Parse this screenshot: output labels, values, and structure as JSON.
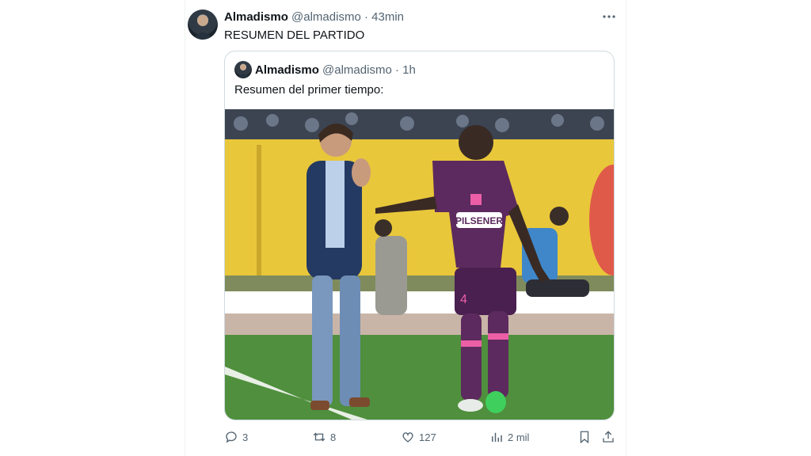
{
  "tweet": {
    "author_name": "Almadismo",
    "handle": "@almadismo",
    "separator": "·",
    "time": "43min",
    "text": "RESUMEN DEL PARTIDO"
  },
  "quoted_tweet": {
    "author_name": "Almadismo",
    "handle": "@almadismo",
    "separator": "·",
    "time": "1h",
    "text": "Resumen del primer tiempo:",
    "image": {
      "sponsor_text": "PILSENER",
      "shirt_number": "4"
    }
  },
  "actions": {
    "replies": "3",
    "reposts": "8",
    "likes": "127",
    "views": "2 mil"
  },
  "colors": {
    "text_primary": "#0f1419",
    "text_secondary": "#536471",
    "border": "#cfd9de",
    "jersey": "#5c2a5e",
    "accent_pink": "#ec5fa7"
  },
  "icons": [
    "more-icon",
    "reply-icon",
    "repost-icon",
    "like-icon",
    "views-icon",
    "bookmark-icon",
    "share-icon"
  ]
}
